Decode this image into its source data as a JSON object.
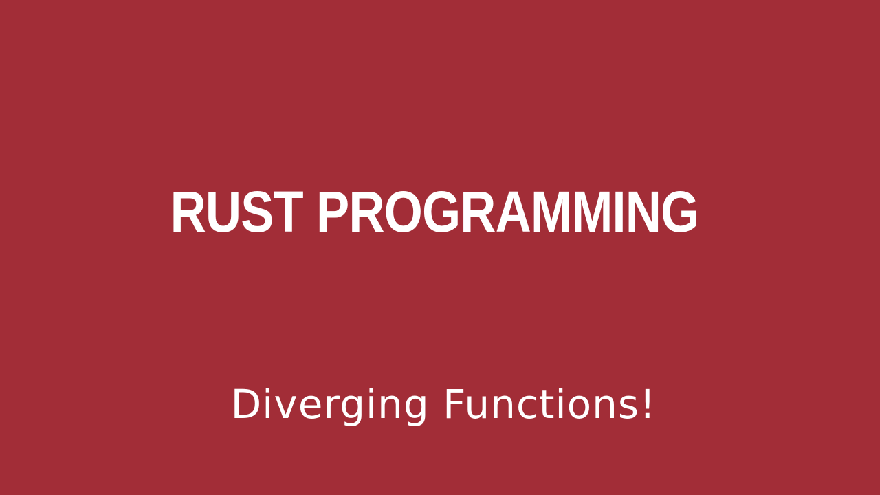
{
  "slide": {
    "title": "RUST PROGRAMMING",
    "subtitle": "Diverging Functions!",
    "background_color": "#a22d37",
    "text_color": "#ffffff"
  }
}
